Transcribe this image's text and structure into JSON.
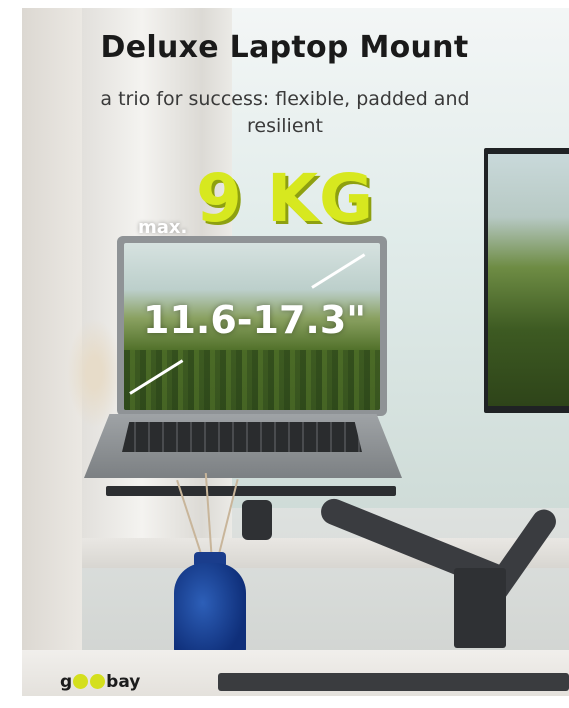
{
  "headline": {
    "title": "Deluxe Laptop Mount",
    "subtitle": "a trio for success: flexible, padded and resilient"
  },
  "badges": {
    "max_label": "max.",
    "weight": "9 KG",
    "screen_size": "11.6-17.3\""
  },
  "brand": {
    "logo_text": "goobay",
    "accent_color": "#d7e81f"
  }
}
